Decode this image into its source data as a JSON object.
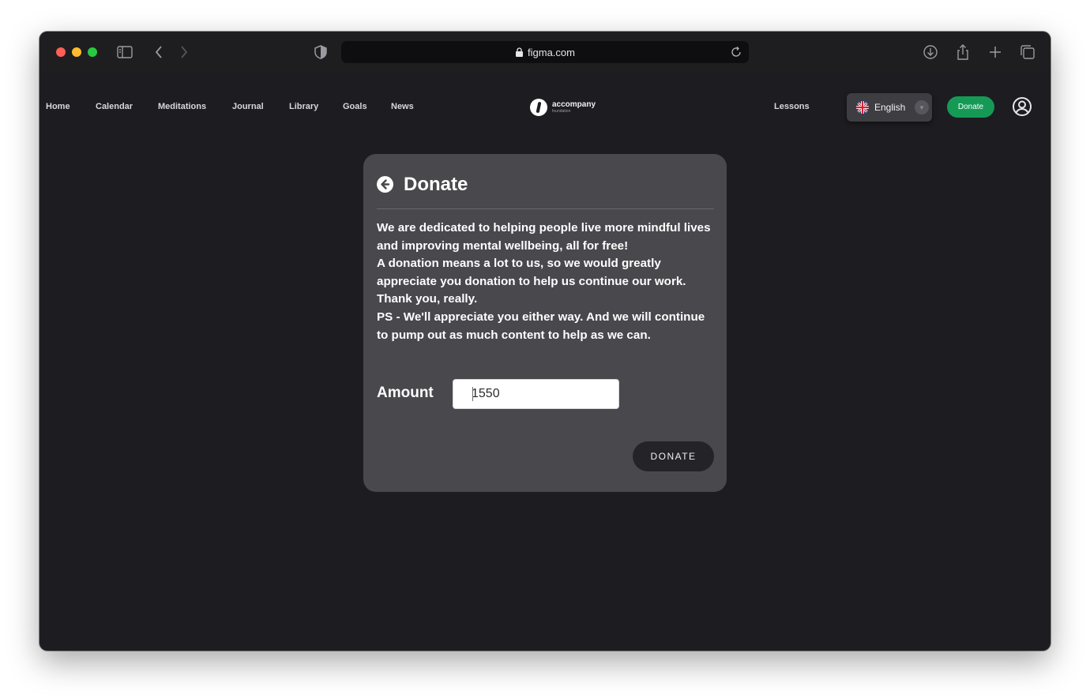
{
  "browser": {
    "url": "figma.com",
    "icons": [
      "sidebar-icon",
      "back-arrow-icon",
      "forward-arrow-icon",
      "shield-icon",
      "lock-icon",
      "reload-icon",
      "download-icon",
      "share-icon",
      "new-tab-icon",
      "tabs-overview-icon"
    ]
  },
  "nav": {
    "links": [
      "Home",
      "Calendar",
      "Meditations",
      "Journal",
      "Library",
      "Goals",
      "News"
    ],
    "logo_name": "accompany",
    "logo_sub": "foundation",
    "lessons": "Lessons",
    "language": "English",
    "donate": "Donate"
  },
  "card": {
    "title": "Donate",
    "paragraphs": [
      "We are dedicated to helping people live more mindful lives and improving mental wellbeing, all for free!",
      "A donation means a lot to us, so we would greatly appreciate you donation to help us continue our work. Thank you, really.",
      "PS - We'll appreciate you either way. And we will continue to pump out as much content to help as we can."
    ],
    "amount_label": "Amount",
    "amount_value": "1550",
    "button_label": "DONATE"
  },
  "colors": {
    "background": "#1d1d21",
    "card": "#48484d",
    "accent_green": "#159a56"
  }
}
